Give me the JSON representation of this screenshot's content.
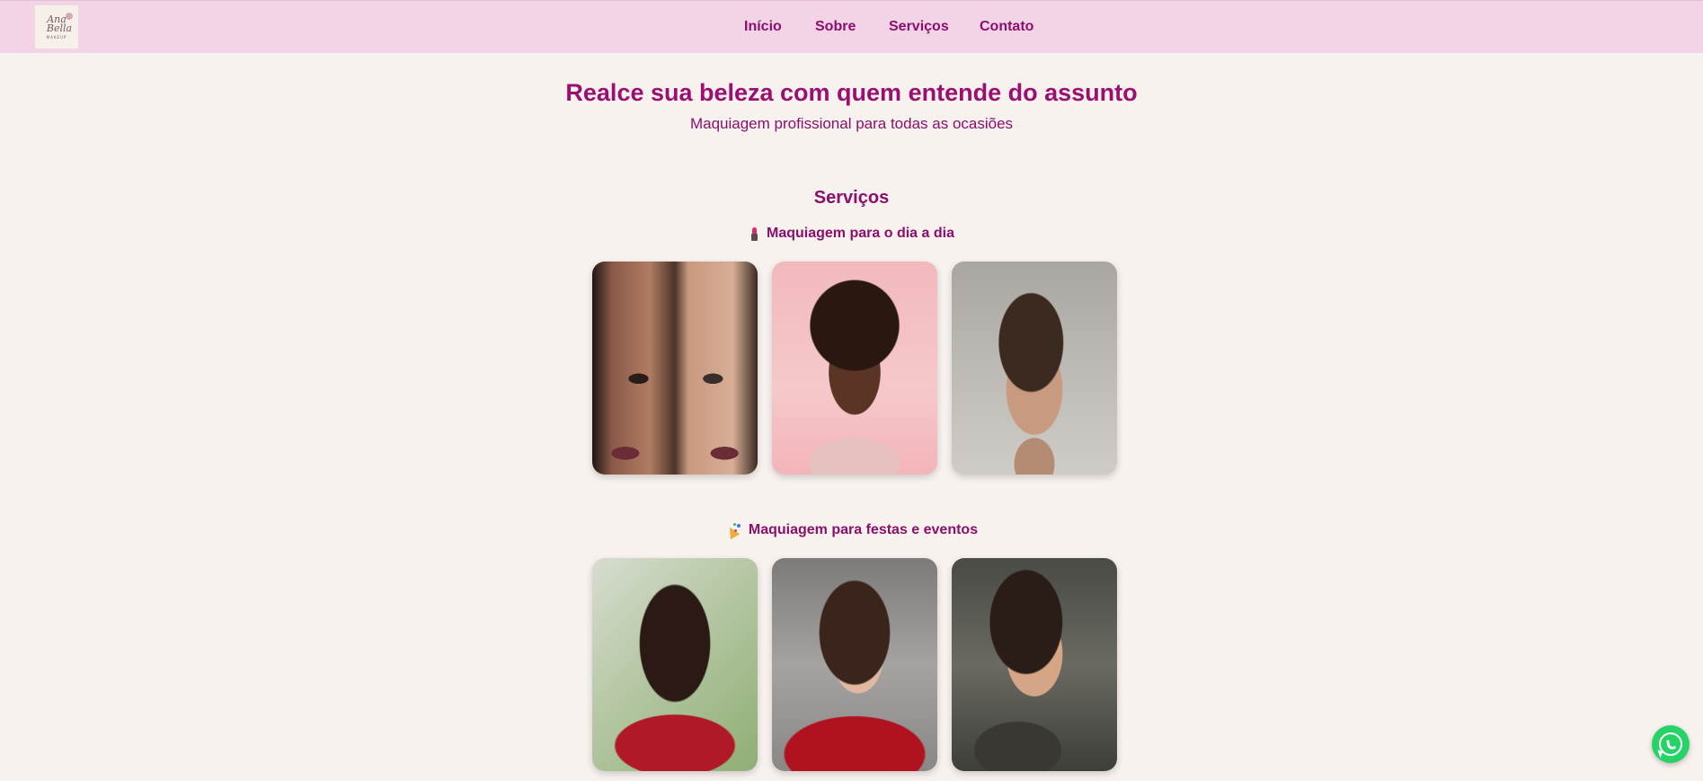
{
  "header": {
    "logo": {
      "line1": "Ana",
      "line2": "Bella",
      "line3": "MAKEUP"
    },
    "nav": [
      {
        "label": "Início"
      },
      {
        "label": "Sobre"
      },
      {
        "label": "Serviços"
      },
      {
        "label": "Contato"
      }
    ]
  },
  "hero": {
    "title": "Realce sua beleza com quem entende do assunto",
    "subtitle": "Maquiagem profissional para todas as ocasiões"
  },
  "services": {
    "title": "Serviços",
    "categories": [
      {
        "title": "Maquiagem para o dia a dia",
        "icon": "lipstick-icon"
      },
      {
        "title": "Maquiagem para festas e eventos",
        "icon": "party-popper-icon"
      }
    ]
  },
  "floating": {
    "icon": "whatsapp-icon"
  },
  "colors": {
    "accent": "#8b0f6d",
    "header_bg": "#f3d3e6",
    "page_bg": "#f8f2ef",
    "whatsapp": "#25d366"
  }
}
